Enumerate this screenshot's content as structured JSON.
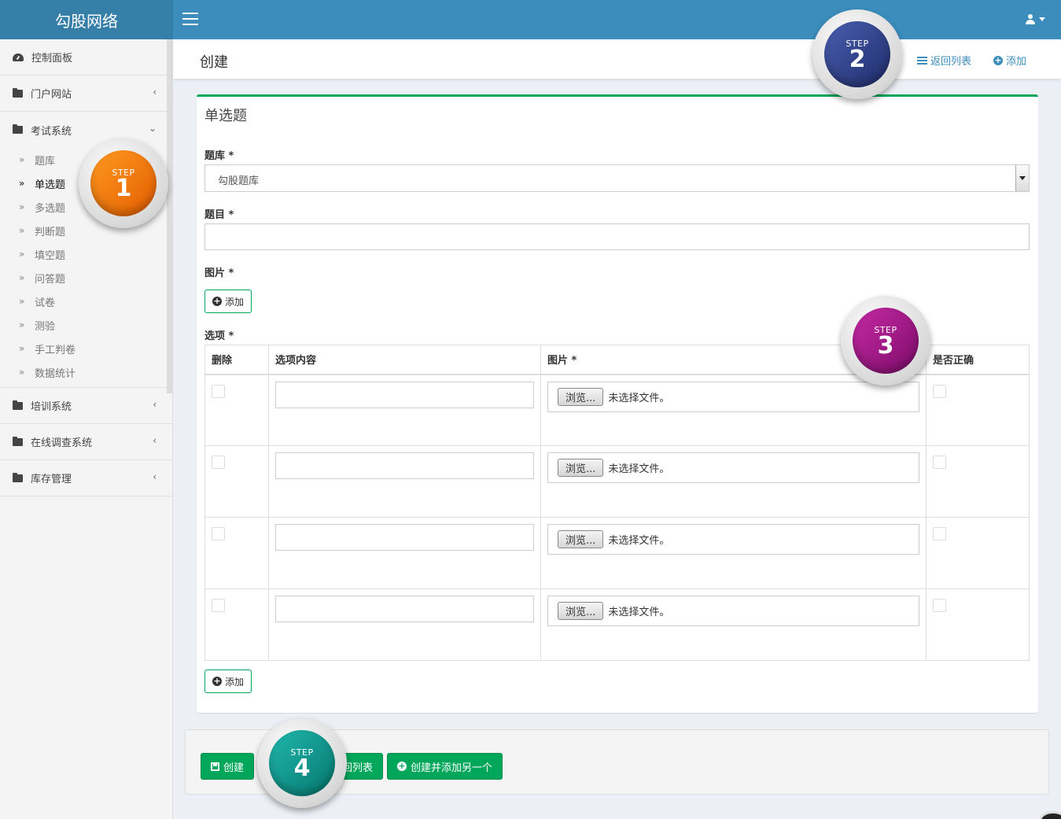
{
  "brand": "勾股网络",
  "sidebar": {
    "dashboard": "控制面板",
    "portal": "门户网站",
    "exam": {
      "label": "考试系统",
      "sub": [
        "题库",
        "单选题",
        "多选题",
        "判断题",
        "填空题",
        "问答题",
        "试卷",
        "测验",
        "手工判卷",
        "数据统计"
      ]
    },
    "training": "培训系统",
    "survey": "在线调查系统",
    "inventory": "库存管理"
  },
  "header": {
    "title": "创建",
    "back_list": "返回列表",
    "add": "添加"
  },
  "form": {
    "box_title": "单选题",
    "bank_label": "题库 *",
    "bank_value": "勾股题库",
    "question_label": "题目 *",
    "image_label": "图片 *",
    "add_btn": "添加",
    "options_label": "选项 *",
    "columns": [
      "删除",
      "选项内容",
      "图片 *",
      "是否正确"
    ],
    "browse": "浏览...",
    "no_file": "未选择文件。",
    "option_rows": 4
  },
  "footer": {
    "create": "创建",
    "back_list_partial": "回列表",
    "create_add_another": "创建并添加另一个"
  },
  "steps": {
    "word": "STEP",
    "s1": "1",
    "s2": "2",
    "s3": "3",
    "s4": "4"
  }
}
